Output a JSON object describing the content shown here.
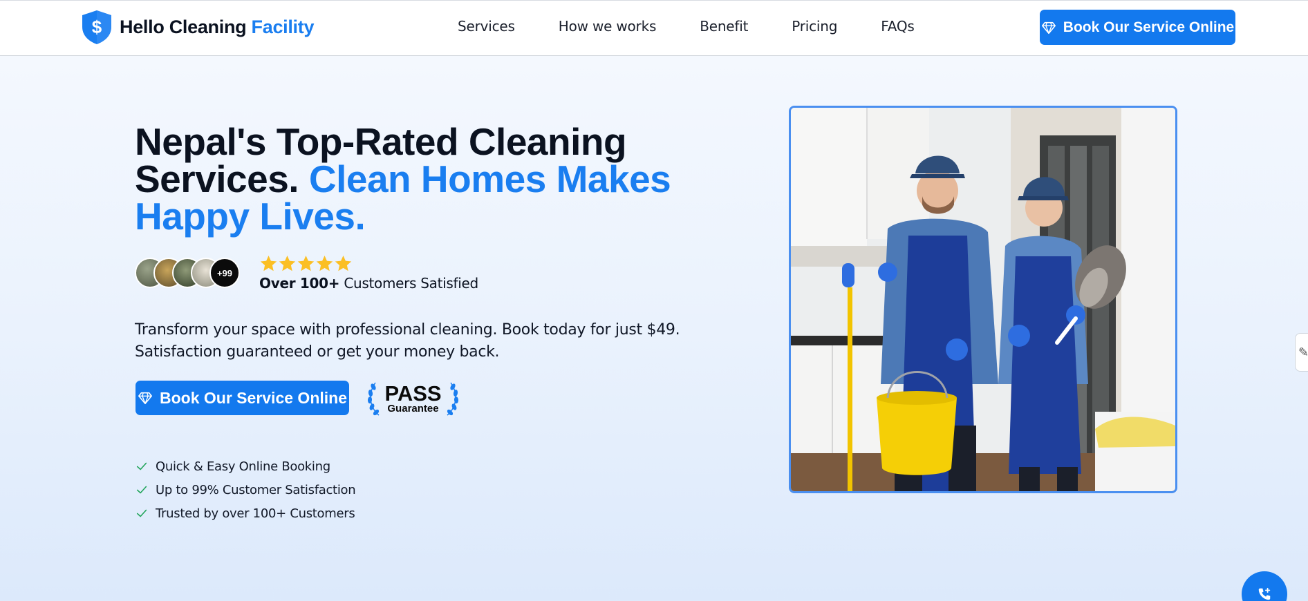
{
  "brand": {
    "name_part1": "Hello Cleaning",
    "name_part2": "Facility",
    "logo_icon": "shield-dollar-icon",
    "logo_symbol": "$"
  },
  "nav": {
    "items": [
      "Services",
      "How we works",
      "Benefit",
      "Pricing",
      "FAQs"
    ]
  },
  "header_cta": {
    "label": "Book Our Service Online",
    "icon": "diamond-icon"
  },
  "hero": {
    "title_dark": "Nepal's Top-Rated Cleaning Services.",
    "title_blue": "Clean Homes Makes Happy Lives.",
    "social_proof": {
      "more_count": "+99",
      "stars": 5,
      "count_bold": "Over 100+",
      "count_rest": "Customers Satisfied"
    },
    "description": "Transform your space with professional cleaning. Book today for just $49. Satisfaction guaranteed or get your money back.",
    "cta": {
      "label": "Book Our Service Online",
      "icon": "diamond-icon"
    },
    "badge": {
      "line1": "PASS",
      "line2": "Guarantee"
    },
    "features": [
      "Quick & Easy Online Booking",
      "Up to 99% Customer Satisfaction",
      "Trusted by over 100+ Customers"
    ]
  },
  "colors": {
    "accent": "#1379ee",
    "brand_blue": "#1a7ef0",
    "star": "#fbbf24",
    "check": "#22a55b",
    "photo_border": "#4a8ff0"
  },
  "widgets": {
    "side_tab_icon": "pencil-icon",
    "call_icon": "phone-plus-icon"
  }
}
